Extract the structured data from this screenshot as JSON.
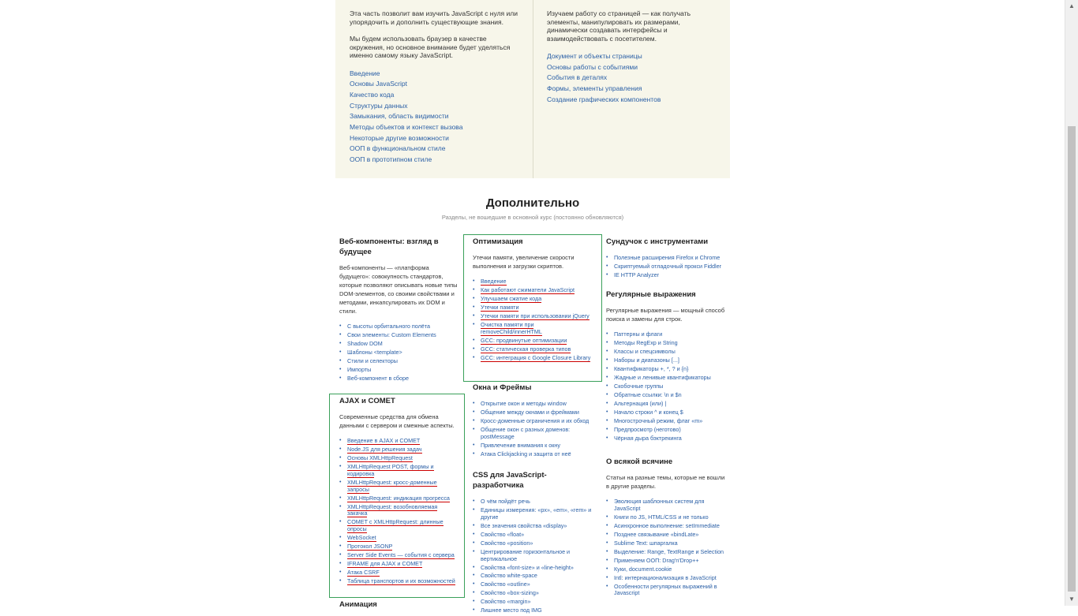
{
  "course": {
    "left": {
      "paragraphs": [
        "Эта часть позволит вам изучить JavaScript с нуля или упорядочить и дополнить существующие знания.",
        "Мы будем использовать браузер в качестве окружения, но основное внимание будет уделяться именно самому языку JavaScript."
      ],
      "links": [
        "Введение",
        "Основы JavaScript",
        "Качество кода",
        "Структуры данных",
        "Замыкания, область видимости",
        "Методы объектов и контекст вызова",
        "Некоторые другие возможности",
        "ООП в функциональном стиле",
        "ООП в прототипном стиле"
      ]
    },
    "right": {
      "paragraphs": [
        "Изучаем работу со страницей — как получать элементы, манипулировать их размерами, динамически создавать интерфейсы и взаимодействовать с посетителем."
      ],
      "links": [
        "Документ и объекты страницы",
        "Основы работы с событиями",
        "События в деталях",
        "Формы, элементы управления",
        "Создание графических компонентов"
      ]
    }
  },
  "extra": {
    "title": "Дополнительно",
    "subtitle": "Разделы, не вошедшие в основной курс (постоянно обновляются)"
  },
  "sections": {
    "webcomponents": {
      "title": "Веб-компоненты: взгляд в будущее",
      "desc": "Веб-компоненты — «платформа будущего»: совокупность стандартов, которые позволяют описывать новые типы DOM-элементов, со своими свойствами и методами, инкапсулировать их DOM и стили.",
      "links": [
        "С высоты орбитального полёта",
        "Свои элементы: Custom Elements",
        "Shadow DOM",
        "Шаблоны <template>",
        "Стили и селекторы",
        "Импорты",
        "Веб-компонент в сборе"
      ]
    },
    "ajax": {
      "title": "AJAX и COMET",
      "desc": "Современные средства для обмена данными с сервером и смежные аспекты.",
      "links": [
        "Введение в AJAX и COMET",
        "Node.JS для решения задач",
        "Основы XMLHttpRequest",
        "XMLHttpRequest POST, формы и кодировка",
        "XMLHttpRequest: кросс-доменные запросы",
        "XMLHttpRequest: индикация прогресса",
        "XMLHttpRequest: возобновляемая закачка",
        "COMET с XMLHttpRequest: длинные опросы",
        "WebSocket",
        "Протокол JSONP",
        "Server Side Events — события с сервера",
        "IFRAME для AJAX и COMET",
        "Атака CSRF",
        "Таблица транспортов и их возможностей"
      ]
    },
    "animation": {
      "title": "Анимация"
    },
    "optimization": {
      "title": "Оптимизация",
      "desc": "Утечки памяти, увеличение скорости выполнения и загрузки скриптов.",
      "links": [
        "Введение",
        "Как работают сжиматели JavaScript",
        "Улучшаем сжатие кода",
        "Утечки памяти",
        "Утечки памяти при использовании jQuery",
        "Очистка памяти при removeChild/innerHTML",
        "GCC: продвинутые оптимизации",
        "GCC: статическая проверка типов",
        "GCC: интеграция с Google Closure Library"
      ]
    },
    "windows": {
      "title": "Окна и Фреймы",
      "links": [
        "Открытие окон и методы window",
        "Общение между окнами и фреймами",
        "Кросс-доменные ограничения и их обход",
        "Общение окон с разных доменов: postMessage",
        "Привлечение внимания к окну",
        "Атака Clickjacking и защита от неё"
      ]
    },
    "css": {
      "title": "CSS для JavaScript-разработчика",
      "links": [
        "О чём пойдёт речь",
        "Единицы измерения: «px», «em», «rem» и другие",
        "Все значения свойства «display»",
        "Свойство «float»",
        "Свойство «position»",
        "Центрирование горизонтальное и вертикальное",
        "Свойства «font-size» и «line-height»",
        "Свойство white-space",
        "Свойство «outline»",
        "Свойство «box-sizing»",
        "Свойство «margin»",
        "Лишнее место под IMG"
      ]
    },
    "tools": {
      "title": "Сундучок с инструментами",
      "links": [
        "Полезные расширения Firefox и Chrome",
        "Скриптуемый отладочный прокси Fiddler",
        "IE HTTP Analyzer"
      ]
    },
    "regexp": {
      "title": "Регулярные выражения",
      "desc": "Регулярные выражения — мощный способ поиска и замены для строк.",
      "links": [
        "Паттерны и флаги",
        "Методы RegExp и String",
        "Классы и спецсимволы",
        "Наборы и диапазоны [...]",
        "Квантификаторы +, *, ? и {n}",
        "Жадные и ленивые квантификаторы",
        "Скобочные группы",
        "Обратные ссылки: \\n и $n",
        "Альтернация (или) |",
        "Начало строки ^ и конец $",
        "Многострочный режим, флаг «m»",
        "Предпросмотр (неготово)",
        "Чёрная дыра бэктрекинга"
      ]
    },
    "misc": {
      "title": "О всякой всячине",
      "desc": "Статьи на разные темы, которые не вошли в другие разделы.",
      "links": [
        "Эволюция шаблонных систем для JavaScript",
        "Книги по JS, HTML/CSS и не только",
        "Асинхронное выполнение: setImmediate",
        "Позднее связывание «bindLate»",
        "Sublime Text: шпаргалка",
        "Выделение: Range, TextRange и Selection",
        "Применяем ООП: Drag'n'Drop++",
        "Куки, document.cookie",
        "Intl: интернационализация в JavaScript",
        "Особенности регулярных выражений в Javascript"
      ]
    }
  }
}
